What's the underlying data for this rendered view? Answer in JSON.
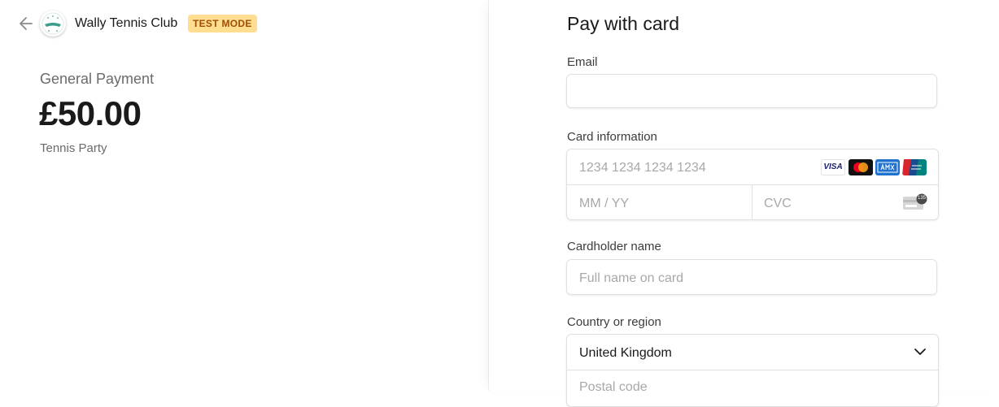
{
  "merchant": {
    "name": "Wally Tennis Club",
    "badge": "TEST MODE",
    "back_icon": "arrow-left-icon",
    "logo_icon": "club-logo"
  },
  "product": {
    "name": "General Payment",
    "price": "£50.00",
    "description": "Tennis Party"
  },
  "form": {
    "title": "Pay with card",
    "email": {
      "label": "Email",
      "value": ""
    },
    "card": {
      "label": "Card information",
      "number_placeholder": "1234 1234 1234 1234",
      "expiry_placeholder": "MM / YY",
      "cvc_placeholder": "CVC",
      "brands": [
        "visa-icon",
        "mastercard-icon",
        "amex-icon",
        "unionpay-icon"
      ],
      "visa_text": "VISA",
      "cvc_icon": "card-cvc-icon",
      "cvc_badge": "135"
    },
    "cardholder": {
      "label": "Cardholder name",
      "placeholder": "Full name on card"
    },
    "country": {
      "label": "Country or region",
      "value": "United Kingdom",
      "postal_placeholder": "Postal code"
    }
  },
  "colors": {
    "badge_bg": "#ffde92",
    "badge_text": "#a04e00",
    "mastercard_red": "#eb001b",
    "mastercard_orange": "#f79e1b",
    "amex_blue": "#1f72cd"
  }
}
